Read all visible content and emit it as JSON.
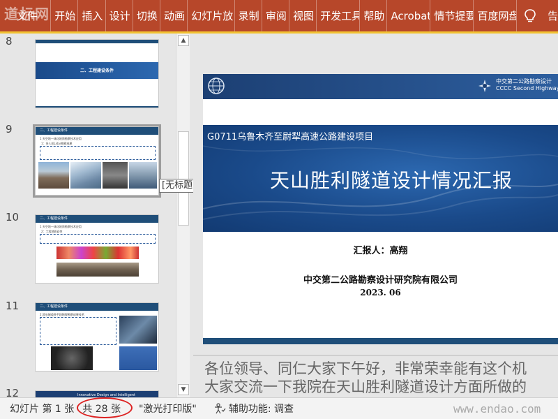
{
  "ribbon": {
    "watermark": "道标网",
    "tabs": [
      "文件",
      "开始",
      "插入",
      "设计",
      "切换",
      "动画",
      "幻灯片放",
      "录制",
      "审阅",
      "视图",
      "开发工具",
      "帮助",
      "Acrobat",
      "情节提要",
      "百度网盘"
    ],
    "tail_label": "告",
    "accent_color": "#b7472a",
    "icon": "lightbulb-icon"
  },
  "thumbnails": {
    "slide_numbers": [
      "8",
      "9",
      "10",
      "11",
      "12"
    ],
    "slide8": {
      "section_title": "二、工程建设条件"
    },
    "slide9": {
      "header_tag": "二、工程建设条件",
      "subtitle": "1 天空地一体化地质勘察技术应用",
      "item": "1：多人机Lidar勘察成果"
    },
    "slide10": {
      "header_tag": "二、工程建设条件",
      "subtitle": "1 天空地一体化地质勘察技术应用",
      "item": "2：工程地质岩性"
    },
    "slide11": {
      "header_tag": "二、工程建设条件",
      "subtitle": "2 超长隧道多手段物探勘察成果技术"
    },
    "slide12": {
      "header_text": "Innovative Design and Intelligent"
    }
  },
  "tooltip": "[无标题]",
  "slide": {
    "company_name_cn": "中交第二公路勘察设计",
    "company_name_en": "CCCC Second Highway Con",
    "project": "G0711乌鲁木齐至尉犁高速公路建设项目",
    "title": "天山胜利隧道设计情况汇报",
    "reporter": "汇报人：高翔",
    "institute": "中交第二公路勘察设计研究院有限公司",
    "date": "2023. 06"
  },
  "notes": {
    "line1": "各位领导、同仁大家下午好，非常荣幸能有这个机",
    "line2": "大家交流一下我院在天山胜利隧道设计方面所做的"
  },
  "status": {
    "slide_position": "幻灯片 第 1 张",
    "slide_count": "共 28 张",
    "theme": "\"激光打印版\"",
    "accessibility": "辅助功能: 调查",
    "site_watermark": "www.endao.com"
  }
}
